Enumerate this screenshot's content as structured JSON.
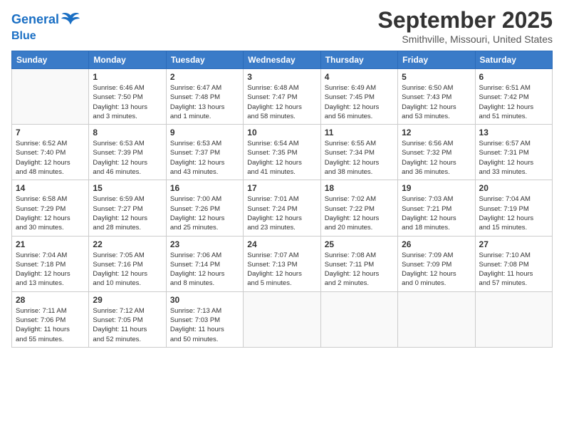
{
  "header": {
    "logo_line1": "General",
    "logo_line2": "Blue",
    "month": "September 2025",
    "location": "Smithville, Missouri, United States"
  },
  "weekdays": [
    "Sunday",
    "Monday",
    "Tuesday",
    "Wednesday",
    "Thursday",
    "Friday",
    "Saturday"
  ],
  "weeks": [
    [
      {
        "day": "",
        "info": ""
      },
      {
        "day": "1",
        "info": "Sunrise: 6:46 AM\nSunset: 7:50 PM\nDaylight: 13 hours\nand 3 minutes."
      },
      {
        "day": "2",
        "info": "Sunrise: 6:47 AM\nSunset: 7:48 PM\nDaylight: 13 hours\nand 1 minute."
      },
      {
        "day": "3",
        "info": "Sunrise: 6:48 AM\nSunset: 7:47 PM\nDaylight: 12 hours\nand 58 minutes."
      },
      {
        "day": "4",
        "info": "Sunrise: 6:49 AM\nSunset: 7:45 PM\nDaylight: 12 hours\nand 56 minutes."
      },
      {
        "day": "5",
        "info": "Sunrise: 6:50 AM\nSunset: 7:43 PM\nDaylight: 12 hours\nand 53 minutes."
      },
      {
        "day": "6",
        "info": "Sunrise: 6:51 AM\nSunset: 7:42 PM\nDaylight: 12 hours\nand 51 minutes."
      }
    ],
    [
      {
        "day": "7",
        "info": "Sunrise: 6:52 AM\nSunset: 7:40 PM\nDaylight: 12 hours\nand 48 minutes."
      },
      {
        "day": "8",
        "info": "Sunrise: 6:53 AM\nSunset: 7:39 PM\nDaylight: 12 hours\nand 46 minutes."
      },
      {
        "day": "9",
        "info": "Sunrise: 6:53 AM\nSunset: 7:37 PM\nDaylight: 12 hours\nand 43 minutes."
      },
      {
        "day": "10",
        "info": "Sunrise: 6:54 AM\nSunset: 7:35 PM\nDaylight: 12 hours\nand 41 minutes."
      },
      {
        "day": "11",
        "info": "Sunrise: 6:55 AM\nSunset: 7:34 PM\nDaylight: 12 hours\nand 38 minutes."
      },
      {
        "day": "12",
        "info": "Sunrise: 6:56 AM\nSunset: 7:32 PM\nDaylight: 12 hours\nand 36 minutes."
      },
      {
        "day": "13",
        "info": "Sunrise: 6:57 AM\nSunset: 7:31 PM\nDaylight: 12 hours\nand 33 minutes."
      }
    ],
    [
      {
        "day": "14",
        "info": "Sunrise: 6:58 AM\nSunset: 7:29 PM\nDaylight: 12 hours\nand 30 minutes."
      },
      {
        "day": "15",
        "info": "Sunrise: 6:59 AM\nSunset: 7:27 PM\nDaylight: 12 hours\nand 28 minutes."
      },
      {
        "day": "16",
        "info": "Sunrise: 7:00 AM\nSunset: 7:26 PM\nDaylight: 12 hours\nand 25 minutes."
      },
      {
        "day": "17",
        "info": "Sunrise: 7:01 AM\nSunset: 7:24 PM\nDaylight: 12 hours\nand 23 minutes."
      },
      {
        "day": "18",
        "info": "Sunrise: 7:02 AM\nSunset: 7:22 PM\nDaylight: 12 hours\nand 20 minutes."
      },
      {
        "day": "19",
        "info": "Sunrise: 7:03 AM\nSunset: 7:21 PM\nDaylight: 12 hours\nand 18 minutes."
      },
      {
        "day": "20",
        "info": "Sunrise: 7:04 AM\nSunset: 7:19 PM\nDaylight: 12 hours\nand 15 minutes."
      }
    ],
    [
      {
        "day": "21",
        "info": "Sunrise: 7:04 AM\nSunset: 7:18 PM\nDaylight: 12 hours\nand 13 minutes."
      },
      {
        "day": "22",
        "info": "Sunrise: 7:05 AM\nSunset: 7:16 PM\nDaylight: 12 hours\nand 10 minutes."
      },
      {
        "day": "23",
        "info": "Sunrise: 7:06 AM\nSunset: 7:14 PM\nDaylight: 12 hours\nand 8 minutes."
      },
      {
        "day": "24",
        "info": "Sunrise: 7:07 AM\nSunset: 7:13 PM\nDaylight: 12 hours\nand 5 minutes."
      },
      {
        "day": "25",
        "info": "Sunrise: 7:08 AM\nSunset: 7:11 PM\nDaylight: 12 hours\nand 2 minutes."
      },
      {
        "day": "26",
        "info": "Sunrise: 7:09 AM\nSunset: 7:09 PM\nDaylight: 12 hours\nand 0 minutes."
      },
      {
        "day": "27",
        "info": "Sunrise: 7:10 AM\nSunset: 7:08 PM\nDaylight: 11 hours\nand 57 minutes."
      }
    ],
    [
      {
        "day": "28",
        "info": "Sunrise: 7:11 AM\nSunset: 7:06 PM\nDaylight: 11 hours\nand 55 minutes."
      },
      {
        "day": "29",
        "info": "Sunrise: 7:12 AM\nSunset: 7:05 PM\nDaylight: 11 hours\nand 52 minutes."
      },
      {
        "day": "30",
        "info": "Sunrise: 7:13 AM\nSunset: 7:03 PM\nDaylight: 11 hours\nand 50 minutes."
      },
      {
        "day": "",
        "info": ""
      },
      {
        "day": "",
        "info": ""
      },
      {
        "day": "",
        "info": ""
      },
      {
        "day": "",
        "info": ""
      }
    ]
  ]
}
